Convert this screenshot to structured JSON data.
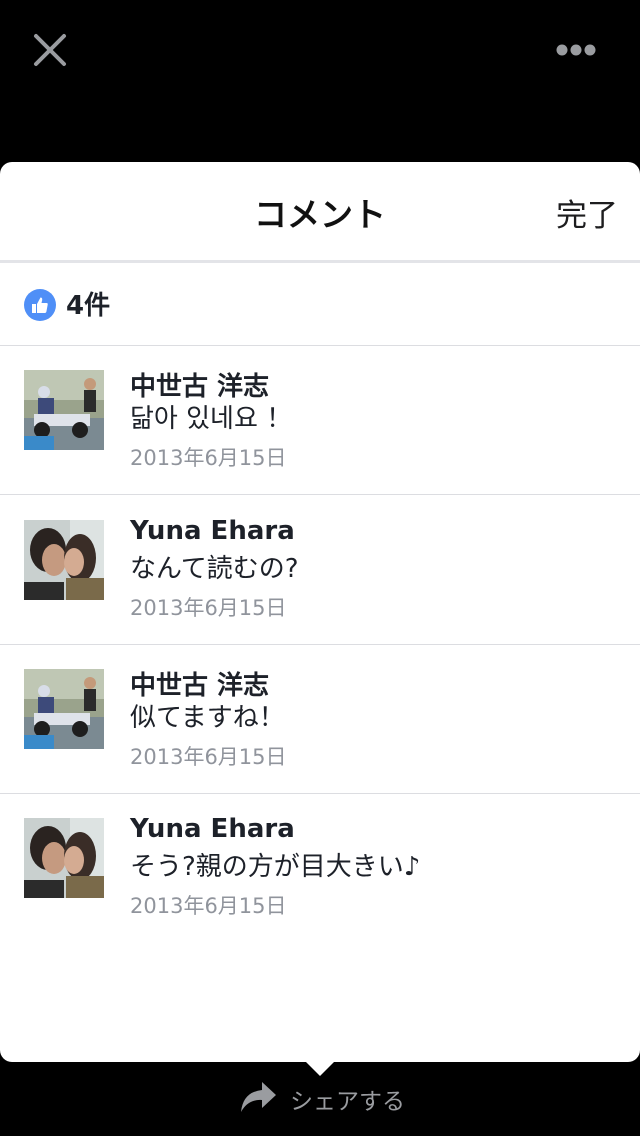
{
  "topbar": {
    "close_icon": "close-icon",
    "more_icon": "more-options-icon"
  },
  "header": {
    "title": "コメント",
    "done_label": "完了"
  },
  "likes": {
    "icon": "thumbs-up-icon",
    "icon_color": "#4f8ff7",
    "count_label": "4件"
  },
  "comments": [
    {
      "author": "中世古 洋志",
      "text": "닮아 있네요 ！",
      "date": "2013年6月15日",
      "avatar": "go-kart-photo"
    },
    {
      "author": "Yuna Ehara",
      "text": "なんて読むの?",
      "date": "2013年6月15日",
      "avatar": "couple-photo"
    },
    {
      "author": "中世古 洋志",
      "text": "似てますね！",
      "date": "2013年6月15日",
      "avatar": "go-kart-photo"
    },
    {
      "author": "Yuna Ehara",
      "text": "そう?親の方が目大きい♪",
      "date": "2013年6月15日",
      "avatar": "couple-photo"
    }
  ],
  "footer": {
    "share_label": "シェアする",
    "share_icon": "share-arrow-icon"
  },
  "colors": {
    "background": "#000000",
    "sheet": "#ffffff",
    "text": "#1d2129",
    "secondary_text": "#90949c"
  }
}
